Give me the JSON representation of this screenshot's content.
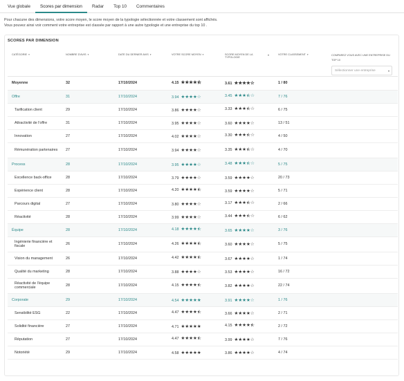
{
  "tabs": [
    "Vue globale",
    "Scores par dimension",
    "Radar",
    "Top 10",
    "Commentaires"
  ],
  "active_tab": 1,
  "intro": {
    "line1": "Pour chacune des dimensions, votre score moyen, le score moyen de la typologie sélectionnée et votre classement sont affichés.",
    "line2": "Vous pouvez ainsi voir comment votre entreprise est classée par rapport à une autre typologie et une entreprise du top 10 ."
  },
  "card_title": "SCORES PAR DIMENSION",
  "columns": {
    "category": "CATÉGORIE",
    "count": "NOMBRE D'AVIS",
    "date": "DATE DU DERNIER AVIS",
    "your_score": "VOTRE SCORE MOYEN",
    "typology_score": "SCORE MOYEN DE LA TYPOLOGIE",
    "rank": "VOTRE CLASSEMENT",
    "compare": "COMPAREZ VOUS AVEC UNE ENTREPRISE DU TOP 10"
  },
  "compare_placeholder": "Sélectionner une entreprise",
  "rows": [
    {
      "type": "avg",
      "name": "Moyenne",
      "count": "32",
      "date": "17/10/2024",
      "score": "4.15",
      "stars": "★★★★⯪",
      "typ": "3.61",
      "typ_stars": "★★★★☆",
      "rank": "1 / 80"
    },
    {
      "type": "group",
      "name": "Offre",
      "count": "31",
      "date": "17/10/2024",
      "score": "3.94",
      "stars": "★★★★☆",
      "typ": "3.45",
      "typ_stars": "★★★⯪☆",
      "rank": "7 / 76"
    },
    {
      "type": "sub",
      "name": "Tarification client",
      "count": "29",
      "date": "17/10/2024",
      "score": "3.86",
      "stars": "★★★★☆",
      "typ": "3.33",
      "typ_stars": "★★★⯪☆",
      "rank": "6 / 75"
    },
    {
      "type": "sub",
      "name": "Attractivité de l'offre",
      "count": "31",
      "date": "17/10/2024",
      "score": "3.95",
      "stars": "★★★★☆",
      "typ": "3.60",
      "typ_stars": "★★★★☆",
      "rank": "13 / 51"
    },
    {
      "type": "sub",
      "name": "Innovation",
      "count": "27",
      "date": "17/10/2024",
      "score": "4.02",
      "stars": "★★★★☆",
      "typ": "3.30",
      "typ_stars": "★★★⯪☆",
      "rank": "4 / 50"
    },
    {
      "type": "sub",
      "tall": true,
      "name": "Rémunération partenaires",
      "count": "27",
      "date": "17/10/2024",
      "score": "3.94",
      "stars": "★★★★☆",
      "typ": "3.35",
      "typ_stars": "★★★⯪☆",
      "rank": "4 / 70"
    },
    {
      "type": "group",
      "name": "Process",
      "count": "28",
      "date": "17/10/2024",
      "score": "3.95",
      "stars": "★★★★☆",
      "typ": "3.48",
      "typ_stars": "★★★⯪☆",
      "rank": "5 / 75"
    },
    {
      "type": "sub",
      "name": "Excellence back-office",
      "count": "28",
      "date": "17/10/2024",
      "score": "3.79",
      "stars": "★★★★☆",
      "typ": "3.59",
      "typ_stars": "★★★★☆",
      "rank": "20 / 73"
    },
    {
      "type": "sub",
      "name": "Expérience client",
      "count": "28",
      "date": "17/10/2024",
      "score": "4.20",
      "stars": "★★★★⯪",
      "typ": "3.59",
      "typ_stars": "★★★★☆",
      "rank": "5 / 71"
    },
    {
      "type": "sub",
      "name": "Parcours digital",
      "count": "27",
      "date": "17/10/2024",
      "score": "3.80",
      "stars": "★★★★☆",
      "typ": "3.17",
      "typ_stars": "★★★⯪☆",
      "rank": "2 / 66"
    },
    {
      "type": "sub",
      "name": "Réactivité",
      "count": "28",
      "date": "17/10/2024",
      "score": "3.99",
      "stars": "★★★★☆",
      "typ": "3.44",
      "typ_stars": "★★★⯪☆",
      "rank": "6 / 62"
    },
    {
      "type": "group",
      "name": "Équipe",
      "count": "28",
      "date": "17/10/2024",
      "score": "4.18",
      "stars": "★★★★⯪",
      "typ": "3.65",
      "typ_stars": "★★★★☆",
      "rank": "3 / 76"
    },
    {
      "type": "sub",
      "tall": true,
      "name": "Ingénierie financière et fiscale",
      "count": "26",
      "date": "17/10/2024",
      "score": "4.26",
      "stars": "★★★★⯪",
      "typ": "3.60",
      "typ_stars": "★★★★☆",
      "rank": "5 / 75"
    },
    {
      "type": "sub",
      "name": "Vision du management",
      "count": "26",
      "date": "17/10/2024",
      "score": "4.42",
      "stars": "★★★★⯪",
      "typ": "3.67",
      "typ_stars": "★★★★☆",
      "rank": "1 / 74"
    },
    {
      "type": "sub",
      "name": "Qualité du marketing",
      "count": "28",
      "date": "17/10/2024",
      "score": "3.88",
      "stars": "★★★★☆",
      "typ": "3.53",
      "typ_stars": "★★★★☆",
      "rank": "16 / 72"
    },
    {
      "type": "sub",
      "tall": true,
      "name": "Réactivité de l'équipe commerciale",
      "count": "28",
      "date": "17/10/2024",
      "score": "4.15",
      "stars": "★★★★⯪",
      "typ": "3.82",
      "typ_stars": "★★★★☆",
      "rank": "22 / 74"
    },
    {
      "type": "group",
      "name": "Corporate",
      "count": "29",
      "date": "17/10/2024",
      "score": "4.54",
      "stars": "★★★★★",
      "typ": "3.91",
      "typ_stars": "★★★★☆",
      "rank": "1 / 76"
    },
    {
      "type": "sub",
      "name": "Sensibilité ESG",
      "count": "22",
      "date": "17/10/2024",
      "score": "4.47",
      "stars": "★★★★⯪",
      "typ": "3.66",
      "typ_stars": "★★★★☆",
      "rank": "2 / 71"
    },
    {
      "type": "sub",
      "name": "Solidité financière",
      "count": "27",
      "date": "17/10/2024",
      "score": "4.71",
      "stars": "★★★★★",
      "typ": "4.15",
      "typ_stars": "★★★★⯪",
      "rank": "2 / 72"
    },
    {
      "type": "sub",
      "name": "Réputation",
      "count": "27",
      "date": "17/10/2024",
      "score": "4.47",
      "stars": "★★★★⯪",
      "typ": "3.99",
      "typ_stars": "★★★★☆",
      "rank": "7 / 76"
    },
    {
      "type": "sub",
      "name": "Notoriété",
      "count": "29",
      "date": "17/10/2024",
      "score": "4.58",
      "stars": "★★★★★",
      "typ": "3.86",
      "typ_stars": "★★★★☆",
      "rank": "4 / 74"
    }
  ],
  "colors": {
    "accent": "#2a8888",
    "group_bg": "#f6f8f8"
  }
}
